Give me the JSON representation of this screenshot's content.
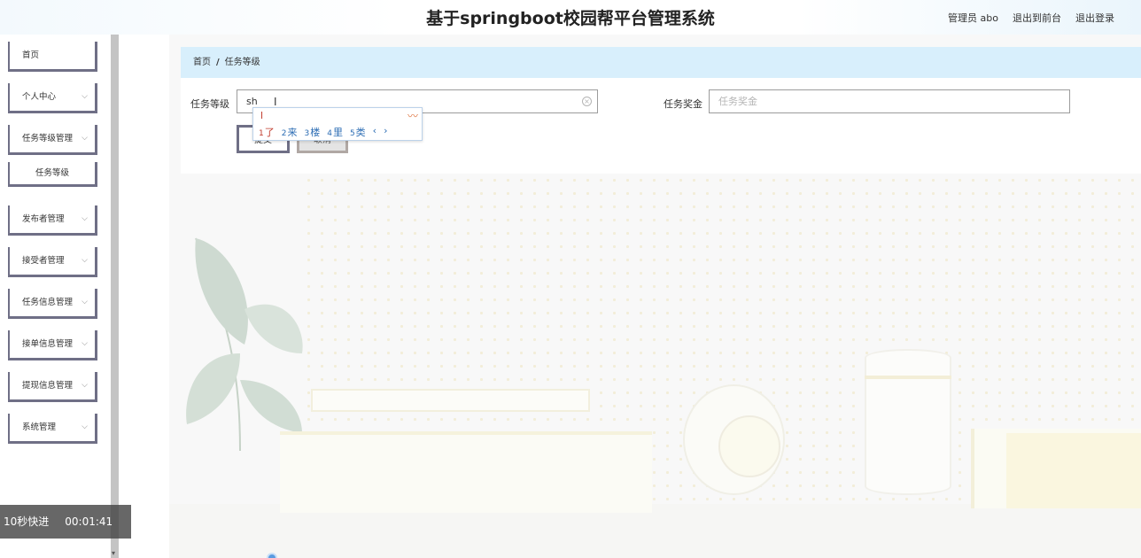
{
  "header": {
    "title": "基于springboot校园帮平台管理系统",
    "user": "管理员 abo",
    "front": "退出到前台",
    "logout": "退出登录"
  },
  "sidebar": {
    "items": [
      {
        "label": "首页"
      },
      {
        "label": "个人中心"
      },
      {
        "label": "任务等级管理"
      },
      {
        "label": "任务等级"
      },
      {
        "label": "发布者管理"
      },
      {
        "label": "接受者管理"
      },
      {
        "label": "任务信息管理"
      },
      {
        "label": "接单信息管理"
      },
      {
        "label": "提现信息管理"
      },
      {
        "label": "系统管理"
      }
    ]
  },
  "breadcrumb": {
    "home": "首页",
    "sep": "/",
    "current": "任务等级"
  },
  "form": {
    "level_label": "任务等级",
    "level_value": "sh",
    "reward_label": "任务奖金",
    "reward_placeholder": "任务奖金",
    "submit": "提交",
    "cancel": "取消"
  },
  "ime": {
    "composition": "l",
    "candidates": [
      {
        "num": "1",
        "text": "了"
      },
      {
        "num": "2",
        "text": "来"
      },
      {
        "num": "3",
        "text": "楼"
      },
      {
        "num": "4",
        "text": "里"
      },
      {
        "num": "5",
        "text": "类"
      }
    ],
    "prev": "‹",
    "next": "›"
  },
  "player": {
    "skip": "10秒快进",
    "time": "00:01:41"
  }
}
